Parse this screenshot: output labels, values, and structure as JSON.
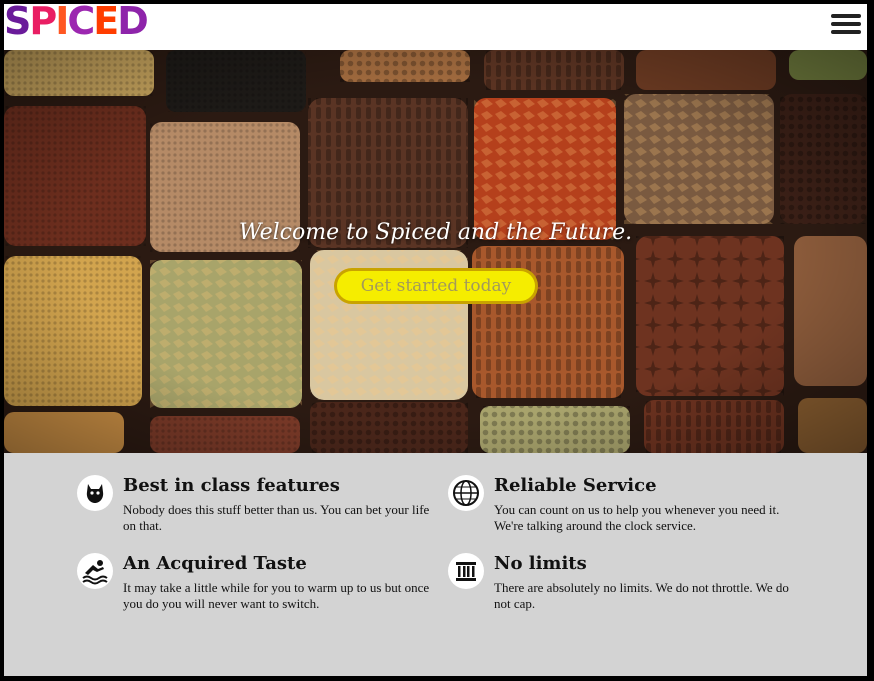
{
  "header": {
    "logo_letters": [
      {
        "char": "S",
        "color": "#6a1b9a"
      },
      {
        "char": "P",
        "color": "#e91e63"
      },
      {
        "char": "I",
        "color": "#ff5722"
      },
      {
        "char": "C",
        "color": "#9c27b0"
      },
      {
        "char": "E",
        "color": "#ff3d00"
      },
      {
        "char": "D",
        "color": "#8e24aa"
      }
    ],
    "menu_icon": "hamburger-menu-icon"
  },
  "hero": {
    "title": "Welcome to Spiced and the Future.",
    "cta_label": "Get started today",
    "cta_color": "#f5ed00"
  },
  "features": [
    {
      "icon": "black-cat-icon",
      "title": "Best in class features",
      "desc": "Nobody does this stuff better than us. You can bet your life on that."
    },
    {
      "icon": "globe-icon",
      "title": "Reliable Service",
      "desc": "You can count on us to help you whenever you need it. We're talking around the clock service."
    },
    {
      "icon": "swimmer-icon",
      "title": "An Acquired Taste",
      "desc": "It may take a little while for you to warm up to us but once you do you will never want to switch."
    },
    {
      "icon": "columns-icon",
      "title": "No limits",
      "desc": "There are absolutely no limits. We do not throttle. We do not cap."
    }
  ]
}
